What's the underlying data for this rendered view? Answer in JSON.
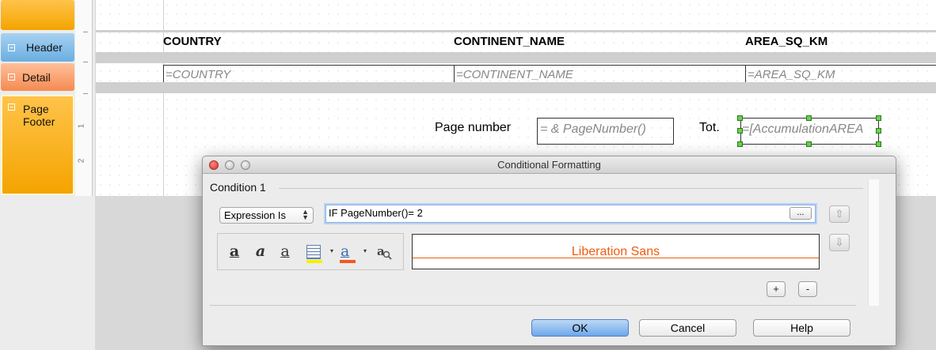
{
  "sections": {
    "header_label": "Header",
    "detail_label": "Detail",
    "footer_label_line1": "Page",
    "footer_label_line2": "Footer",
    "expand_symbol": "⊟"
  },
  "ruler": {
    "marks": [
      "1",
      "2"
    ]
  },
  "page_header": {
    "columns": [
      "COUNTRY",
      "CONTINENT_NAME",
      "AREA_SQ_KM"
    ]
  },
  "detail": {
    "fields": [
      "=COUNTRY",
      "=CONTINENT_NAME",
      "=AREA_SQ_KM"
    ]
  },
  "page_footer": {
    "page_number_label": "Page number",
    "page_number_field": "= &  PageNumber()",
    "tot_label": "Tot.",
    "tot_field": "=[AccumulationAREA"
  },
  "dialog": {
    "title": "Conditional Formatting",
    "condition_title": "Condition 1",
    "condition_type": "Expression Is",
    "expression_value": "IF PageNumber()= 2",
    "browse_label": "...",
    "preview_text": "Liberation Sans",
    "toolbar": {
      "bold_glyph": "a",
      "italic_glyph": "a",
      "underline_glyph": "a",
      "font_color_glyph": "a",
      "dropdown_glyph": "▾",
      "background_color_hex": "#f6f000",
      "font_color_hex": "#f05a20"
    },
    "add_label": "+",
    "remove_label": "-",
    "up_glyph": "⇧",
    "down_glyph": "⇩",
    "buttons": {
      "ok": "OK",
      "cancel": "Cancel",
      "help": "Help"
    }
  },
  "colors": {
    "preview_font": "#f05a10",
    "header_tab": "#6aaee0",
    "detail_tab": "#f58a50",
    "footer_tab": "#f4a400"
  }
}
